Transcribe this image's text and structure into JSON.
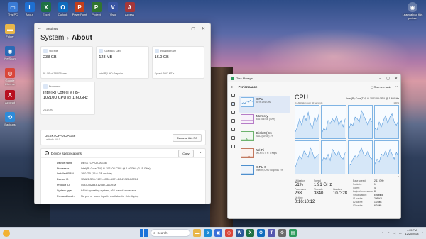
{
  "desktop": {
    "top_icons": [
      {
        "name": "this-pc-icon",
        "label": "This PC",
        "color": "#3a7bd5",
        "glyph": "▭"
      },
      {
        "name": "about-icon",
        "label": "About",
        "color": "#1e6fd1",
        "glyph": "i"
      },
      {
        "name": "excel-icon",
        "label": "Excel",
        "color": "#1e7145",
        "glyph": "X"
      },
      {
        "name": "outlook-icon",
        "label": "Outlook",
        "color": "#0f6cbd",
        "glyph": "O"
      },
      {
        "name": "powerpoint-icon",
        "label": "PowerPoint",
        "color": "#c43e1c",
        "glyph": "P"
      },
      {
        "name": "project-icon",
        "label": "Project",
        "color": "#31752f",
        "glyph": "P"
      },
      {
        "name": "visio-icon",
        "label": "Visio",
        "color": "#3955a3",
        "glyph": "V"
      },
      {
        "name": "access-icon",
        "label": "Access",
        "color": "#a4373a",
        "glyph": "A"
      }
    ],
    "left_icons": [
      {
        "name": "folder-icon",
        "label": "Folder",
        "color": "#e8b64a",
        "glyph": "▬"
      },
      {
        "name": "netscan-icon",
        "label": "NetScan",
        "color": "#2a6ab5",
        "glyph": "◉"
      },
      {
        "name": "chrome-icon",
        "label": "Google Chrome",
        "color": "#d9463a",
        "glyph": "◎"
      },
      {
        "name": "acrobat-icon",
        "label": "Acrobat",
        "color": "#b8101f",
        "glyph": "A"
      },
      {
        "name": "backup-icon",
        "label": "Backups",
        "color": "#2e8bd8",
        "glyph": "⟲"
      }
    ],
    "learn_label": "Learn about this picture"
  },
  "settings": {
    "window_title": "Settings",
    "breadcrumb_parent": "System",
    "breadcrumb_sep": "›",
    "breadcrumb_current": "About",
    "storage": {
      "head": "Storage",
      "value": "238 GB",
      "sub": "91 GB of 238 GB used"
    },
    "graphics": {
      "head": "Graphics Card",
      "value": "128 MB",
      "sub": "Intel(R) UHD Graphics"
    },
    "ram": {
      "head": "Installed RAM",
      "value": "16.0 GB",
      "sub": "Speed: 2667 MT/s"
    },
    "processor": {
      "head": "Processor",
      "value": "Intel(R) Core(TM) i5-10210U CPU @ 1.60GHz",
      "sub": "2.11 GHz"
    },
    "device_name": "DESKTOP-UIOAG46",
    "device_model": "Latitude 5410",
    "rename_label": "Rename this PC",
    "specs_title": "Device specifications",
    "copy_label": "Copy",
    "specs": [
      {
        "k": "Device name",
        "v": "DESKTOP-UIOAG46"
      },
      {
        "k": "Processor",
        "v": "Intel(R) Core(TM) i5-10210U CPU @ 1.60GHz (2.11 GHz)"
      },
      {
        "k": "Installed RAM",
        "v": "16.0 GB (15.6 GB usable)"
      },
      {
        "k": "Device ID",
        "v": "7DAEDSD1-74E1-4C80-A571-BB47C2BC8ED1"
      },
      {
        "k": "Product ID",
        "v": "00330-52833-12082-AAOEM"
      },
      {
        "k": "System type",
        "v": "64-bit operating system, x64-based processor"
      },
      {
        "k": "Pen and touch",
        "v": "No pen or touch input is available for this display"
      }
    ]
  },
  "taskmgr": {
    "window_title": "Task Manager",
    "section": "Performance",
    "run_task": "Run new task",
    "items": [
      {
        "name": "CPU",
        "sub": "51% 1.91 GHz",
        "kind": "cpu"
      },
      {
        "name": "Memory",
        "sub": "6.3/15.6 GB (40%)",
        "kind": "mem"
      },
      {
        "name": "Disk 0 (C:)",
        "sub": "SSD (NVMe) 1%",
        "kind": "disk"
      },
      {
        "name": "Wi-Fi",
        "sub": "Wi-Fi S: 0 R: 0 Kbps",
        "kind": "wifi"
      },
      {
        "name": "GPU 0",
        "sub": "Intel(R) UHD Graphics 1%",
        "kind": "gpu"
      }
    ],
    "cpu_title": "CPU",
    "cpu_model": "Intel(R) Core(TM) i5-10210U CPU @ 1.60GHz",
    "axis_left": "% Utilization over 60 seconds",
    "axis_right": "100%",
    "axis_bottom_right": "0",
    "cores": [
      [
        20,
        35,
        60,
        40,
        70,
        55,
        80,
        45,
        30,
        65,
        50,
        75
      ],
      [
        15,
        30,
        25,
        55,
        45,
        60,
        50,
        70,
        40,
        55,
        35,
        60
      ],
      [
        25,
        45,
        40,
        65,
        60,
        50,
        85,
        70,
        55,
        40,
        60,
        50
      ],
      [
        30,
        25,
        50,
        35,
        55,
        70,
        45,
        65,
        75,
        50,
        40,
        55
      ],
      [
        20,
        40,
        55,
        45,
        70,
        60,
        50,
        80,
        65,
        45,
        55,
        60
      ],
      [
        35,
        50,
        45,
        60,
        40,
        75,
        65,
        55,
        70,
        50,
        45,
        65
      ],
      [
        25,
        30,
        45,
        55,
        50,
        65,
        80,
        60,
        55,
        70,
        50,
        45
      ],
      [
        30,
        45,
        35,
        60,
        55,
        70,
        50,
        75,
        60,
        45,
        65,
        55
      ]
    ],
    "utilization": {
      "label": "Utilization",
      "value": "51%"
    },
    "speed": {
      "label": "Speed",
      "value": "1.91 GHz"
    },
    "processes": {
      "label": "Processes",
      "value": "233"
    },
    "threads": {
      "label": "Threads",
      "value": "3840"
    },
    "handles": {
      "label": "Handles",
      "value": "107328"
    },
    "uptime": {
      "label": "Up time",
      "value": "0:16:10:12"
    },
    "details": [
      {
        "k": "Base speed:",
        "v": "2.11 GHz"
      },
      {
        "k": "Sockets:",
        "v": "1"
      },
      {
        "k": "Cores:",
        "v": "4"
      },
      {
        "k": "Logical processors:",
        "v": "8"
      },
      {
        "k": "Virtualization:",
        "v": "Enabled"
      },
      {
        "k": "L1 cache:",
        "v": "256 KB"
      },
      {
        "k": "L2 cache:",
        "v": "1.0 MB"
      },
      {
        "k": "L3 cache:",
        "v": "6.0 MB"
      }
    ]
  },
  "taskbar": {
    "search_placeholder": "Search",
    "apps": [
      {
        "name": "file-explorer-icon",
        "color": "#e8b64a",
        "glyph": "▬"
      },
      {
        "name": "edge-icon",
        "color": "#1c8bd6",
        "glyph": "e"
      },
      {
        "name": "store-icon",
        "color": "#3b6fd8",
        "glyph": "▣"
      },
      {
        "name": "chrome-icon",
        "color": "#d9463a",
        "glyph": "◎"
      },
      {
        "name": "word-icon",
        "color": "#2b579a",
        "glyph": "W"
      },
      {
        "name": "excel-icon",
        "color": "#1e7145",
        "glyph": "X"
      },
      {
        "name": "outlook-icon",
        "color": "#0f6cbd",
        "glyph": "O"
      },
      {
        "name": "teams-icon",
        "color": "#5558af",
        "glyph": "T"
      },
      {
        "name": "settings-icon",
        "color": "#6b6b6b",
        "glyph": "⚙"
      },
      {
        "name": "task-manager-icon",
        "color": "#2b9a5b",
        "glyph": "▤"
      }
    ],
    "time": "4:05 PM",
    "date": "12/20/2024"
  }
}
